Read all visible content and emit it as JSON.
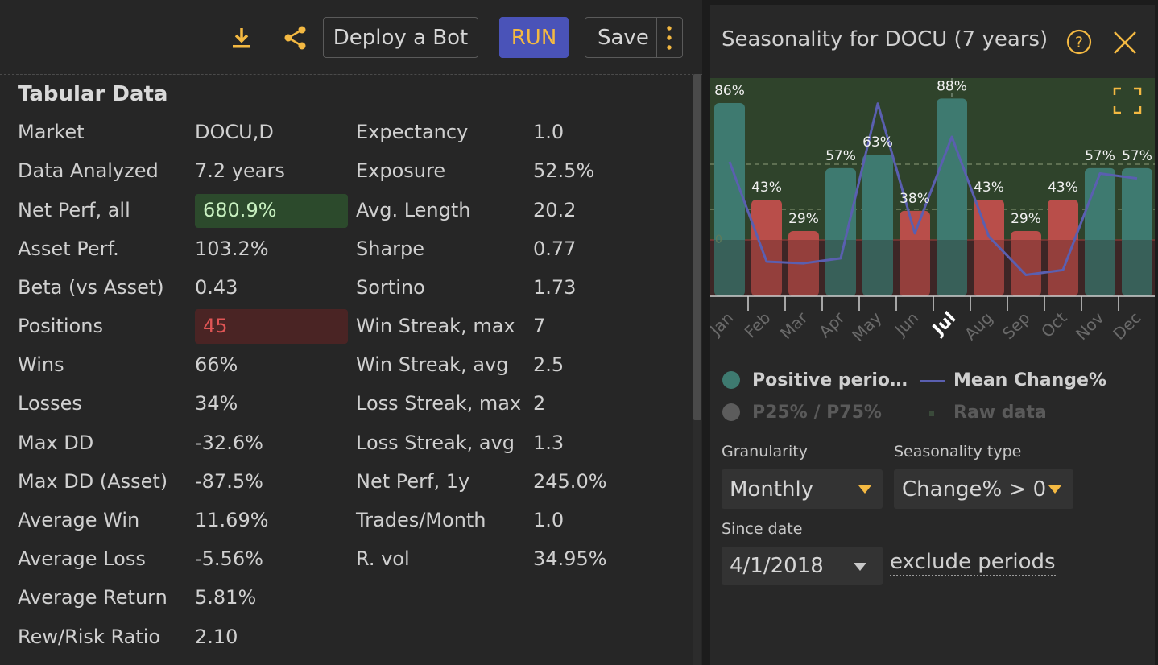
{
  "toolbar": {
    "download_icon": "download-icon",
    "share_icon": "share-icon",
    "deploy_label": "Deploy a Bot",
    "run_label": "RUN",
    "save_label": "Save",
    "more_icon": "more-vertical-icon"
  },
  "tabular": {
    "title": "Tabular Data",
    "left_rows": [
      {
        "label": "Market",
        "value": "DOCU,D"
      },
      {
        "label": "Data Analyzed",
        "value": "7.2 years"
      },
      {
        "label": "Net Perf, all",
        "value": "680.9%"
      },
      {
        "label": "Asset Perf.",
        "value": "103.2%"
      },
      {
        "label": "Beta (vs Asset)",
        "value": "0.43"
      },
      {
        "label": "Positions",
        "value": "45"
      },
      {
        "label": "Wins",
        "value": "66%"
      },
      {
        "label": "Losses",
        "value": "34%"
      },
      {
        "label": "Max DD",
        "value": "-32.6%"
      },
      {
        "label": "Max DD (Asset)",
        "value": "-87.5%"
      },
      {
        "label": "Average Win",
        "value": "11.69%"
      },
      {
        "label": "Average Loss",
        "value": "-5.56%"
      },
      {
        "label": "Average Return",
        "value": "5.81%"
      },
      {
        "label": "Rew/Risk Ratio",
        "value": "2.10"
      }
    ],
    "right_rows": [
      {
        "label": "Expectancy",
        "value": "1.0"
      },
      {
        "label": "Exposure",
        "value": "52.5%"
      },
      {
        "label": "Avg. Length",
        "value": "20.2"
      },
      {
        "label": "Sharpe",
        "value": "0.77"
      },
      {
        "label": "Sortino",
        "value": "1.73"
      },
      {
        "label": "Win Streak, max",
        "value": "7"
      },
      {
        "label": "Win Streak, avg",
        "value": "2.5"
      },
      {
        "label": "Loss Streak, max",
        "value": "2"
      },
      {
        "label": "Loss Streak, avg",
        "value": "1.3"
      },
      {
        "label": "Net Perf, 1y",
        "value": "245.0%"
      },
      {
        "label": "Trades/Month",
        "value": "1.0"
      },
      {
        "label": "R. vol",
        "value": "34.95%"
      }
    ],
    "colors": {
      "positive": "#c8f0c0",
      "negative": "#e05555"
    }
  },
  "seasonality": {
    "title": "Seasonality for DOCU (7 years)",
    "help_icon": "help-circle-icon",
    "close_icon": "close-icon",
    "expand_icon": "expand-icon",
    "legend": {
      "positive": "Positive perio…",
      "mean": "Mean Change%",
      "p25": "P25% / P75%",
      "raw": "Raw data"
    },
    "granularity_label": "Granularity",
    "granularity_value": "Monthly",
    "type_label": "Seasonality type",
    "type_value": "Change% > 0",
    "since_label": "Since date",
    "since_value": "4/1/2018",
    "exclude_label": "exclude periods",
    "colors": {
      "accent": "#f4b942",
      "positive_bar": "#3e7a70",
      "negative_bar": "#b94e4a",
      "mean_line": "#5a5fb0"
    }
  },
  "chart_data": {
    "type": "bar",
    "categories": [
      "Jan",
      "Feb",
      "Mar",
      "Apr",
      "May",
      "Jun",
      "Jul",
      "Aug",
      "Sep",
      "Oct",
      "Nov",
      "Dec"
    ],
    "highlighted_category": "Jul",
    "series": [
      {
        "name": "Positive periods",
        "values": [
          86,
          43,
          29,
          57,
          63,
          38,
          88,
          43,
          29,
          43,
          57,
          57
        ],
        "labels": [
          "86%",
          "43%",
          "29%",
          "57%",
          "63%",
          "38%",
          "88%",
          "43%",
          "29%",
          "43%",
          "57%",
          "57%"
        ]
      },
      {
        "name": "Mean Change%",
        "values": [
          4.5,
          -1.5,
          -1.6,
          -1.3,
          8.0,
          0.2,
          6.0,
          0.0,
          -2.3,
          -2.0,
          3.8,
          3.5
        ]
      }
    ],
    "ylim": [
      0,
      100
    ],
    "threshold": 50,
    "zero_label": "0",
    "grid": true
  }
}
